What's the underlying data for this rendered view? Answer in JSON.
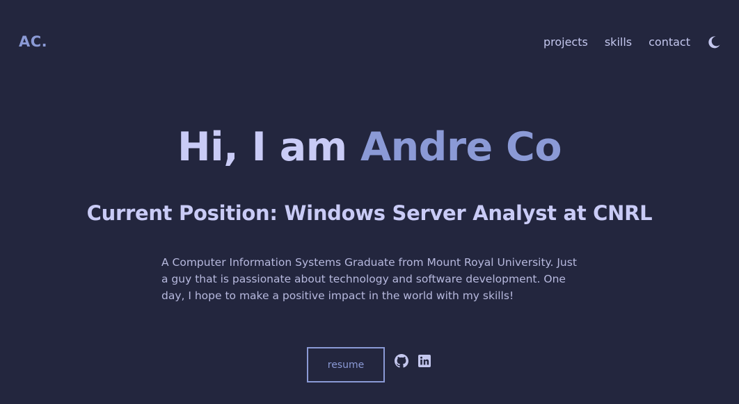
{
  "header": {
    "logo": "AC.",
    "nav": [
      {
        "label": "projects"
      },
      {
        "label": "skills"
      },
      {
        "label": "contact"
      }
    ],
    "theme_toggle_icon": "moon-icon"
  },
  "hero": {
    "greeting": "Hi, I am",
    "name": "Andre Co",
    "position": "Current Position: Windows Server Analyst at CNRL",
    "bio": "A Computer Information Systems Graduate from Mount Royal University. Just a guy that is passionate about technology and software development. One day, I hope to make a positive impact in the world with my skills!",
    "resume_label": "resume",
    "social_icons": [
      "github-icon",
      "linkedin-icon"
    ]
  },
  "colors": {
    "background": "#23263e",
    "accent": "#8b9ad6",
    "text": "#c9cbf6"
  }
}
